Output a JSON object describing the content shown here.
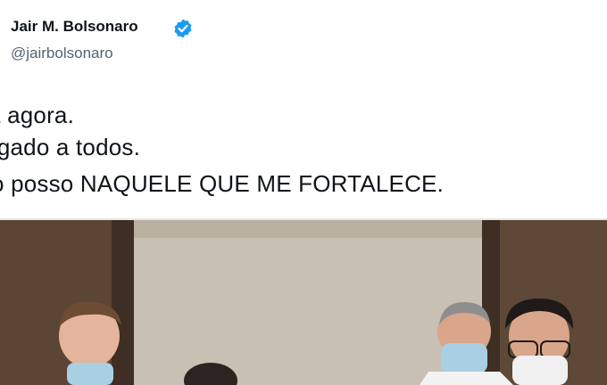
{
  "tweet": {
    "author_name": "Jair M. Bolsonaro",
    "author_handle": "@jairbolsonaro",
    "verified_icon": "verified-badge-icon",
    "lines": [
      "a agora.",
      "rigado a todos.",
      "o posso NAQUELE QUE ME FORTALECE."
    ]
  },
  "media": {
    "type": "photo",
    "icon": "tweet-photo"
  },
  "colors": {
    "text": "#0f1419",
    "secondary": "#536471",
    "verified": "#1d9bf0"
  }
}
